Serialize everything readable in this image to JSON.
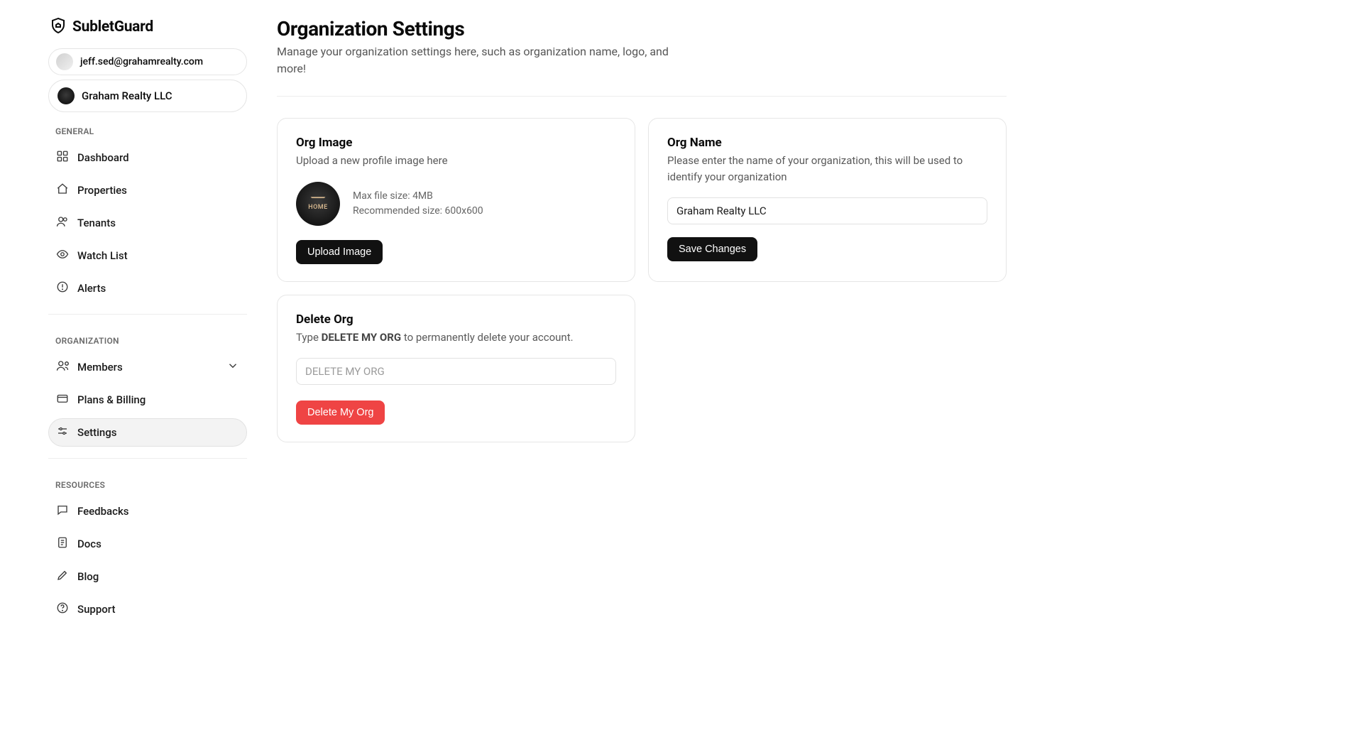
{
  "brand": "SubletGuard",
  "user_email": "jeff.sed@grahamrealty.com",
  "org_name": "Graham Realty LLC",
  "sidebar": {
    "sections": {
      "general": {
        "label": "GENERAL",
        "items": [
          {
            "label": "Dashboard"
          },
          {
            "label": "Properties"
          },
          {
            "label": "Tenants"
          },
          {
            "label": "Watch List"
          },
          {
            "label": "Alerts"
          }
        ]
      },
      "organization": {
        "label": "ORGANIZATION",
        "items": [
          {
            "label": "Members"
          },
          {
            "label": "Plans & Billing"
          },
          {
            "label": "Settings"
          }
        ]
      },
      "resources": {
        "label": "RESOURCES",
        "items": [
          {
            "label": "Feedbacks"
          },
          {
            "label": "Docs"
          },
          {
            "label": "Blog"
          },
          {
            "label": "Support"
          }
        ]
      }
    }
  },
  "page": {
    "title": "Organization Settings",
    "subtitle": "Manage your organization settings here, such as organization name, logo, and more!"
  },
  "card_image": {
    "title": "Org Image",
    "subtitle": "Upload a new profile image here",
    "max_size": "Max file size: 4MB",
    "rec_size": "Recommended size: 600x600",
    "button": "Upload Image"
  },
  "card_name": {
    "title": "Org Name",
    "subtitle": "Please enter the name of your organization, this will be used to identify your organization",
    "value": "Graham Realty LLC",
    "button": "Save Changes"
  },
  "card_delete": {
    "title": "Delete Org",
    "prefix": "Type ",
    "bold": "DELETE MY ORG",
    "suffix": " to permanently delete your account.",
    "placeholder": "DELETE MY ORG",
    "button": "Delete My Org"
  }
}
